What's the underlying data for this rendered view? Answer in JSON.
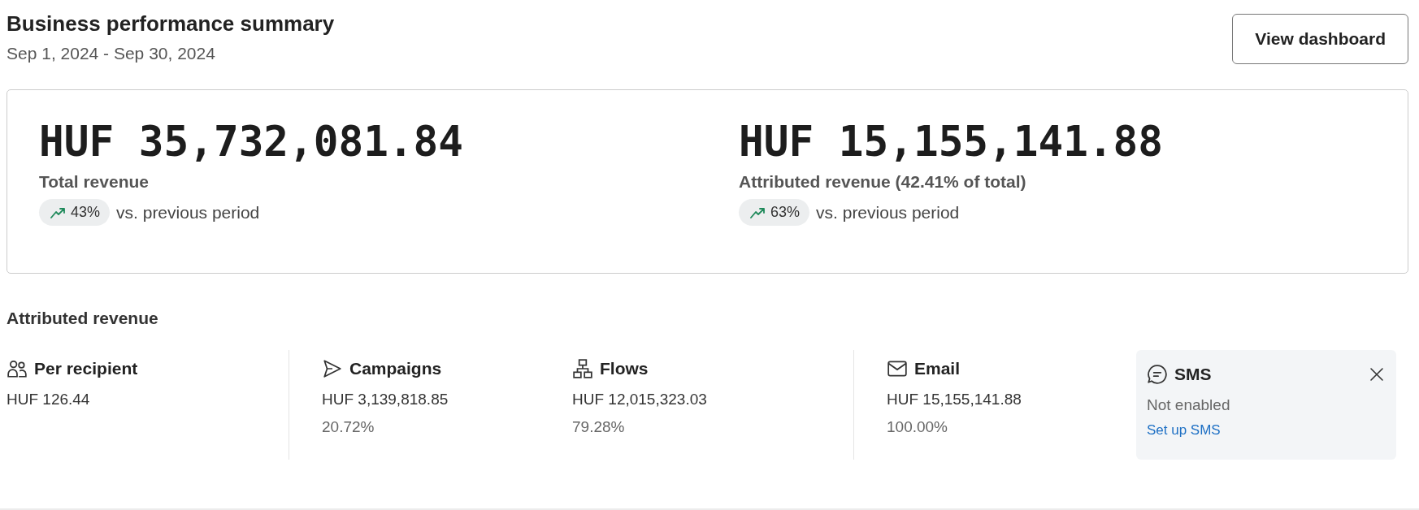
{
  "header": {
    "title": "Business performance summary",
    "date_range": "Sep 1, 2024 - Sep 30, 2024",
    "button": "View dashboard"
  },
  "summary": [
    {
      "value": "HUF 35,732,081.84",
      "label": "Total revenue",
      "change": "43%",
      "comparison": "vs. previous period"
    },
    {
      "value": "HUF 15,155,141.88",
      "label": "Attributed revenue (42.41% of total)",
      "change": "63%",
      "comparison": "vs. previous period"
    }
  ],
  "attributed_revenue": {
    "title": "Attributed revenue",
    "groups": [
      [
        {
          "kind": "recipient",
          "label": "Per recipient",
          "value": "HUF 126.44"
        }
      ],
      [
        {
          "kind": "campaigns",
          "label": "Campaigns",
          "value": "HUF 3,139,818.85",
          "share": "20.72%"
        },
        {
          "kind": "flows",
          "label": "Flows",
          "value": "HUF 12,015,323.03",
          "share": "79.28%"
        }
      ],
      [
        {
          "kind": "email",
          "label": "Email",
          "value": "HUF 15,155,141.88",
          "share": "100.00%"
        }
      ]
    ],
    "sms": {
      "label": "SMS",
      "status": "Not enabled",
      "link": "Set up SMS"
    }
  }
}
